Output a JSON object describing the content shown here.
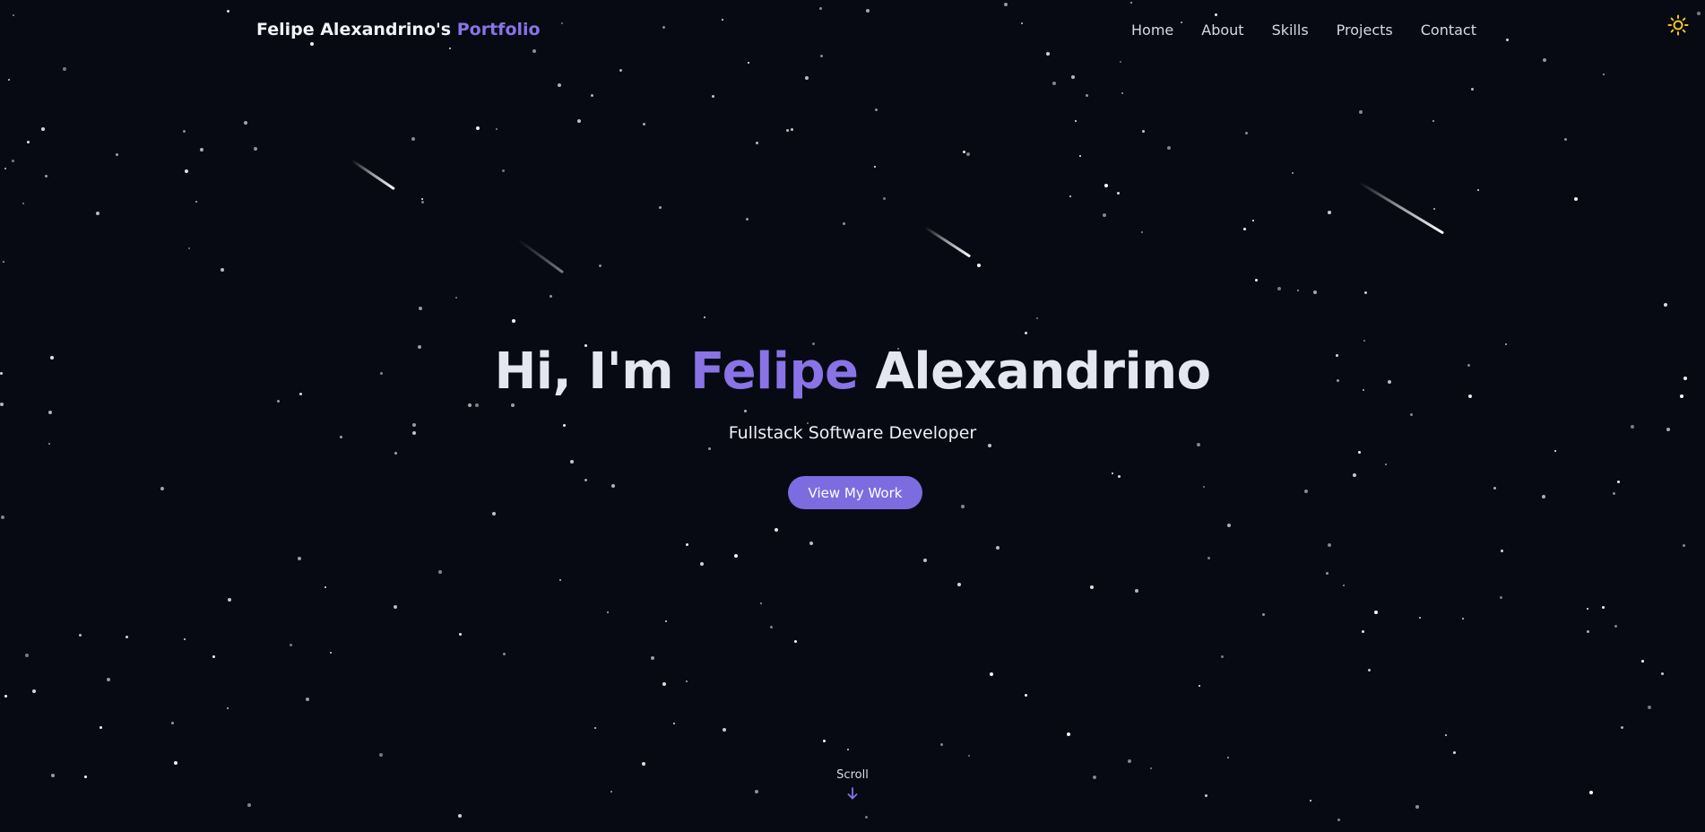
{
  "nav": {
    "brand_name": "Felipe Alexandrino's",
    "brand_accent": "Portfolio",
    "links": [
      "Home",
      "About",
      "Skills",
      "Projects",
      "Contact"
    ],
    "theme_icon": "sun-icon"
  },
  "hero": {
    "greeting": "Hi, I'm",
    "first_name": "Felipe",
    "last_name": "Alexandrino",
    "subtitle": "Fullstack Software Developer",
    "cta_label": "View My Work"
  },
  "scroll": {
    "label": "Scroll",
    "icon": "arrow-down-icon"
  },
  "colors": {
    "background": "#070a13",
    "accent": "#8a73e6",
    "button": "#7c6ce0",
    "sun": "#f5c518"
  }
}
